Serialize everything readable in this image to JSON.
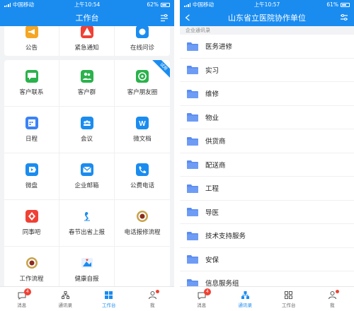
{
  "left": {
    "status": {
      "carrier": "中国移动",
      "time": "上午10:54",
      "battery": "62%"
    },
    "title": "工作台",
    "top_items": [
      {
        "label": "公告",
        "color": "#f5a623",
        "icon": "megaphone-icon"
      },
      {
        "label": "紧急通知",
        "color": "#f04134",
        "icon": "alert-icon"
      },
      {
        "label": "在线问诊",
        "color": "#1a8cf0",
        "icon": "stethoscope-icon"
      }
    ],
    "apps": [
      {
        "label": "客户联系",
        "color": "#2bb24c",
        "icon": "chat-icon",
        "name": "app-customer-contact"
      },
      {
        "label": "客户群",
        "color": "#2bb24c",
        "icon": "group-icon",
        "name": "app-customer-group"
      },
      {
        "label": "客户朋友圈",
        "color": "#2bb24c",
        "icon": "moments-icon",
        "name": "app-customer-moments",
        "corner": "试用"
      },
      {
        "label": "日程",
        "color": "#3b82f6",
        "icon": "calendar-icon",
        "name": "app-schedule"
      },
      {
        "label": "会议",
        "color": "#1a8cf0",
        "icon": "meeting-icon",
        "name": "app-meeting"
      },
      {
        "label": "微文档",
        "color": "#1a8cf0",
        "icon": "doc-icon",
        "name": "app-docs"
      },
      {
        "label": "微盘",
        "color": "#1a8cf0",
        "icon": "drive-icon",
        "name": "app-drive"
      },
      {
        "label": "企业邮箱",
        "color": "#1a8cf0",
        "icon": "mail-icon",
        "name": "app-mail"
      },
      {
        "label": "公费电话",
        "color": "#1a8cf0",
        "icon": "phone-icon",
        "name": "app-phone"
      },
      {
        "label": "同事吧",
        "color": "#f04134",
        "icon": "colleague-icon",
        "name": "app-colleague"
      },
      {
        "label": "春节出省上报",
        "color": "#ffffff",
        "icon": "figure-icon",
        "name": "app-spring-report"
      },
      {
        "label": "电话报修流程",
        "color": "#ffffff",
        "icon": "seal-icon",
        "name": "app-repair"
      },
      {
        "label": "工作流程",
        "color": "#ffffff",
        "icon": "seal-icon",
        "name": "app-workflow"
      },
      {
        "label": "健康自报",
        "color": "#ffffff",
        "icon": "health-icon",
        "name": "app-health"
      },
      {
        "label": "",
        "color": "#ffffff",
        "icon": "",
        "name": "app-empty"
      }
    ],
    "tabs": [
      {
        "label": "消息",
        "badge": "4"
      },
      {
        "label": "通讯录"
      },
      {
        "label": "工作台",
        "active": true
      },
      {
        "label": "我",
        "dot": true
      }
    ]
  },
  "right": {
    "status": {
      "carrier": "中国移动",
      "time": "上午10:57",
      "battery": "61%"
    },
    "title": "山东省立医院协作单位",
    "section": "企业通讯录",
    "folders": [
      "医务进修",
      "实习",
      "维修",
      "物业",
      "供货商",
      "配送商",
      "工程",
      "导医",
      "技术支持服务",
      "安保",
      "信息服务组"
    ],
    "tabs": [
      {
        "label": "消息",
        "badge": "4"
      },
      {
        "label": "通讯录",
        "active": true
      },
      {
        "label": "工作台"
      },
      {
        "label": "我",
        "dot": true
      }
    ]
  },
  "colors": {
    "accent": "#1a8cf0",
    "badge": "#f04134",
    "folder": "#5a8cf0"
  }
}
